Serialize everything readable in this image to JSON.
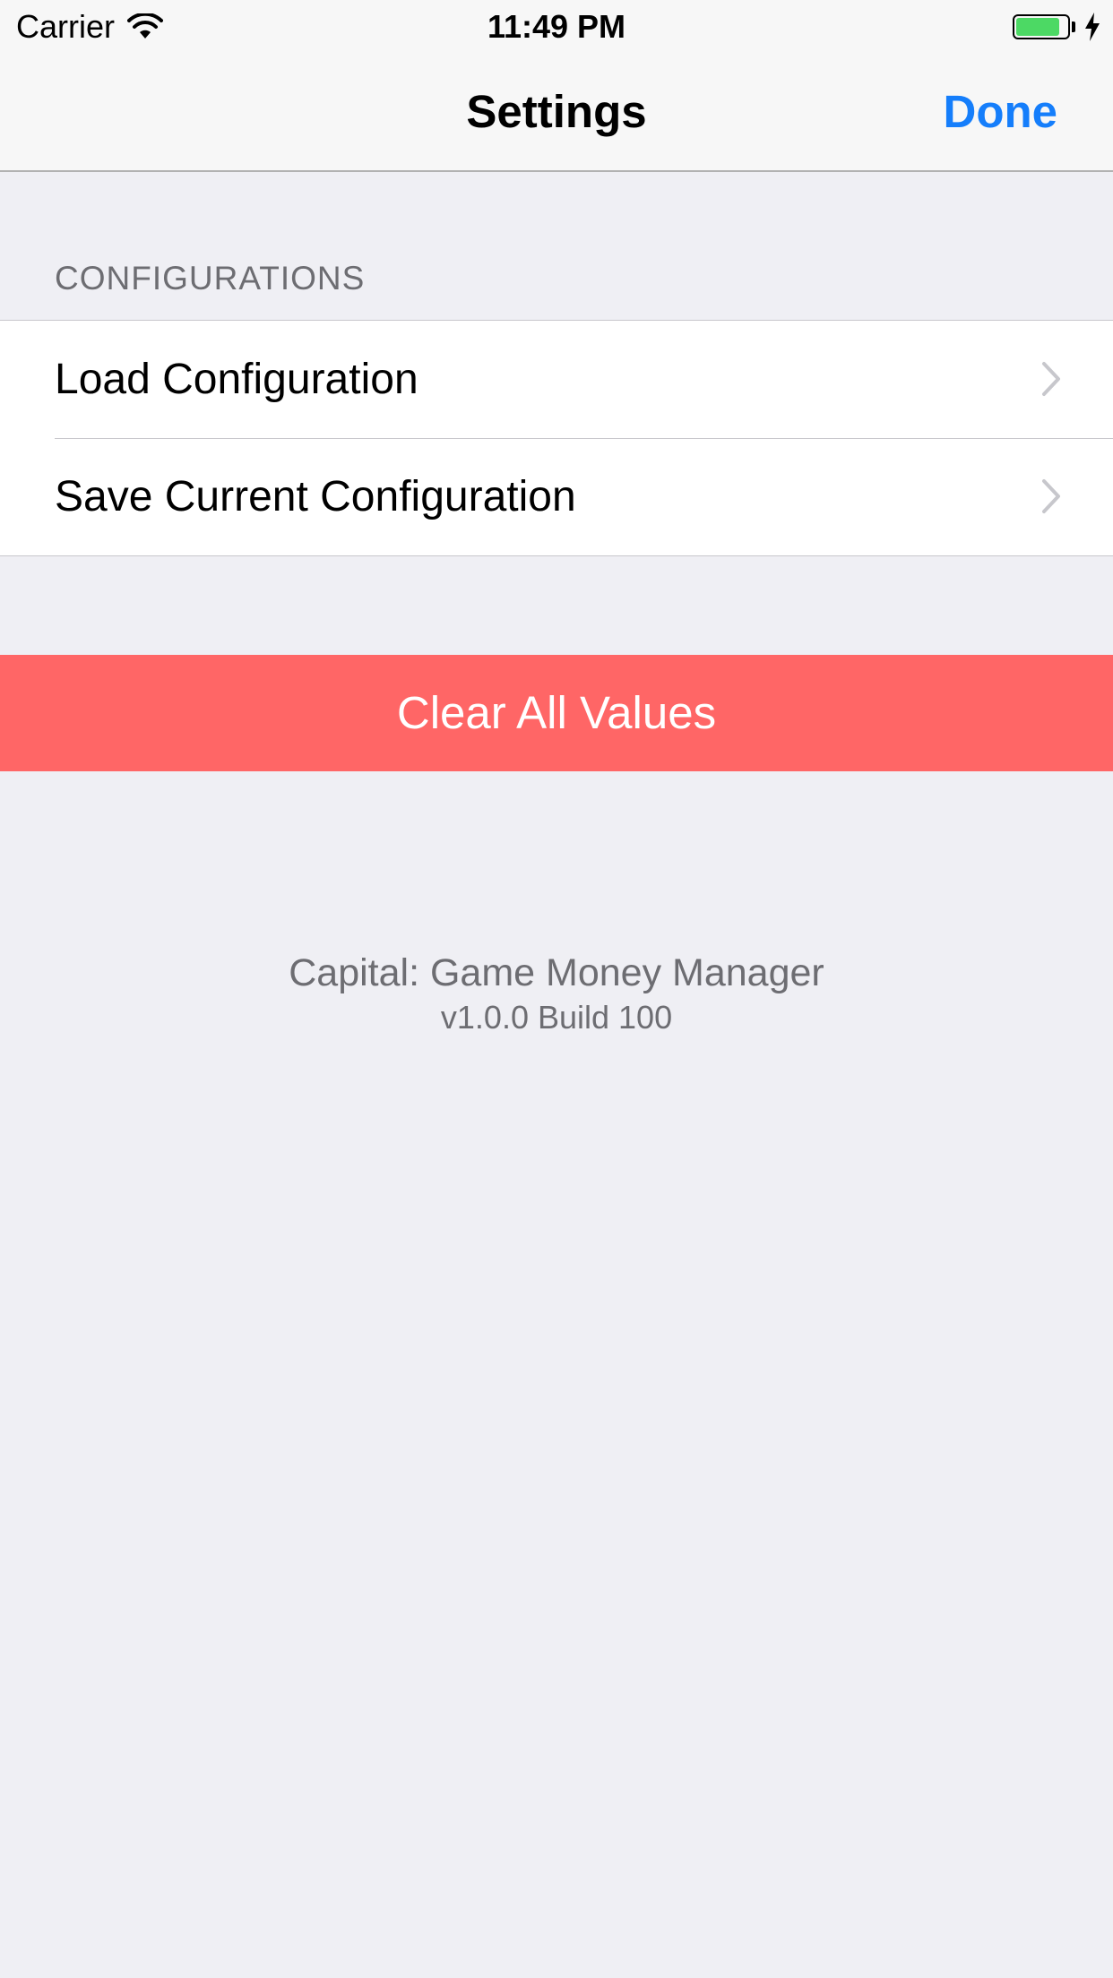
{
  "status_bar": {
    "carrier": "Carrier",
    "time": "11:49 PM",
    "wifi_icon": "wifi-icon",
    "battery_icon": "battery-icon",
    "charging_icon": "bolt-icon",
    "battery_level": 0.85,
    "battery_color": "#4cd964"
  },
  "nav": {
    "title": "Settings",
    "done_label": "Done",
    "accent_color": "#157efb"
  },
  "configurations": {
    "header": "CONFIGURATIONS",
    "items": [
      {
        "label": "Load Configuration",
        "icon": "chevron-right-icon"
      },
      {
        "label": "Save Current Configuration",
        "icon": "chevron-right-icon"
      }
    ]
  },
  "clear_button": {
    "label": "Clear All Values",
    "color": "#ff6666"
  },
  "footer": {
    "app_name": "Capital: Game Money Manager",
    "version": "v1.0.0 Build 100"
  }
}
